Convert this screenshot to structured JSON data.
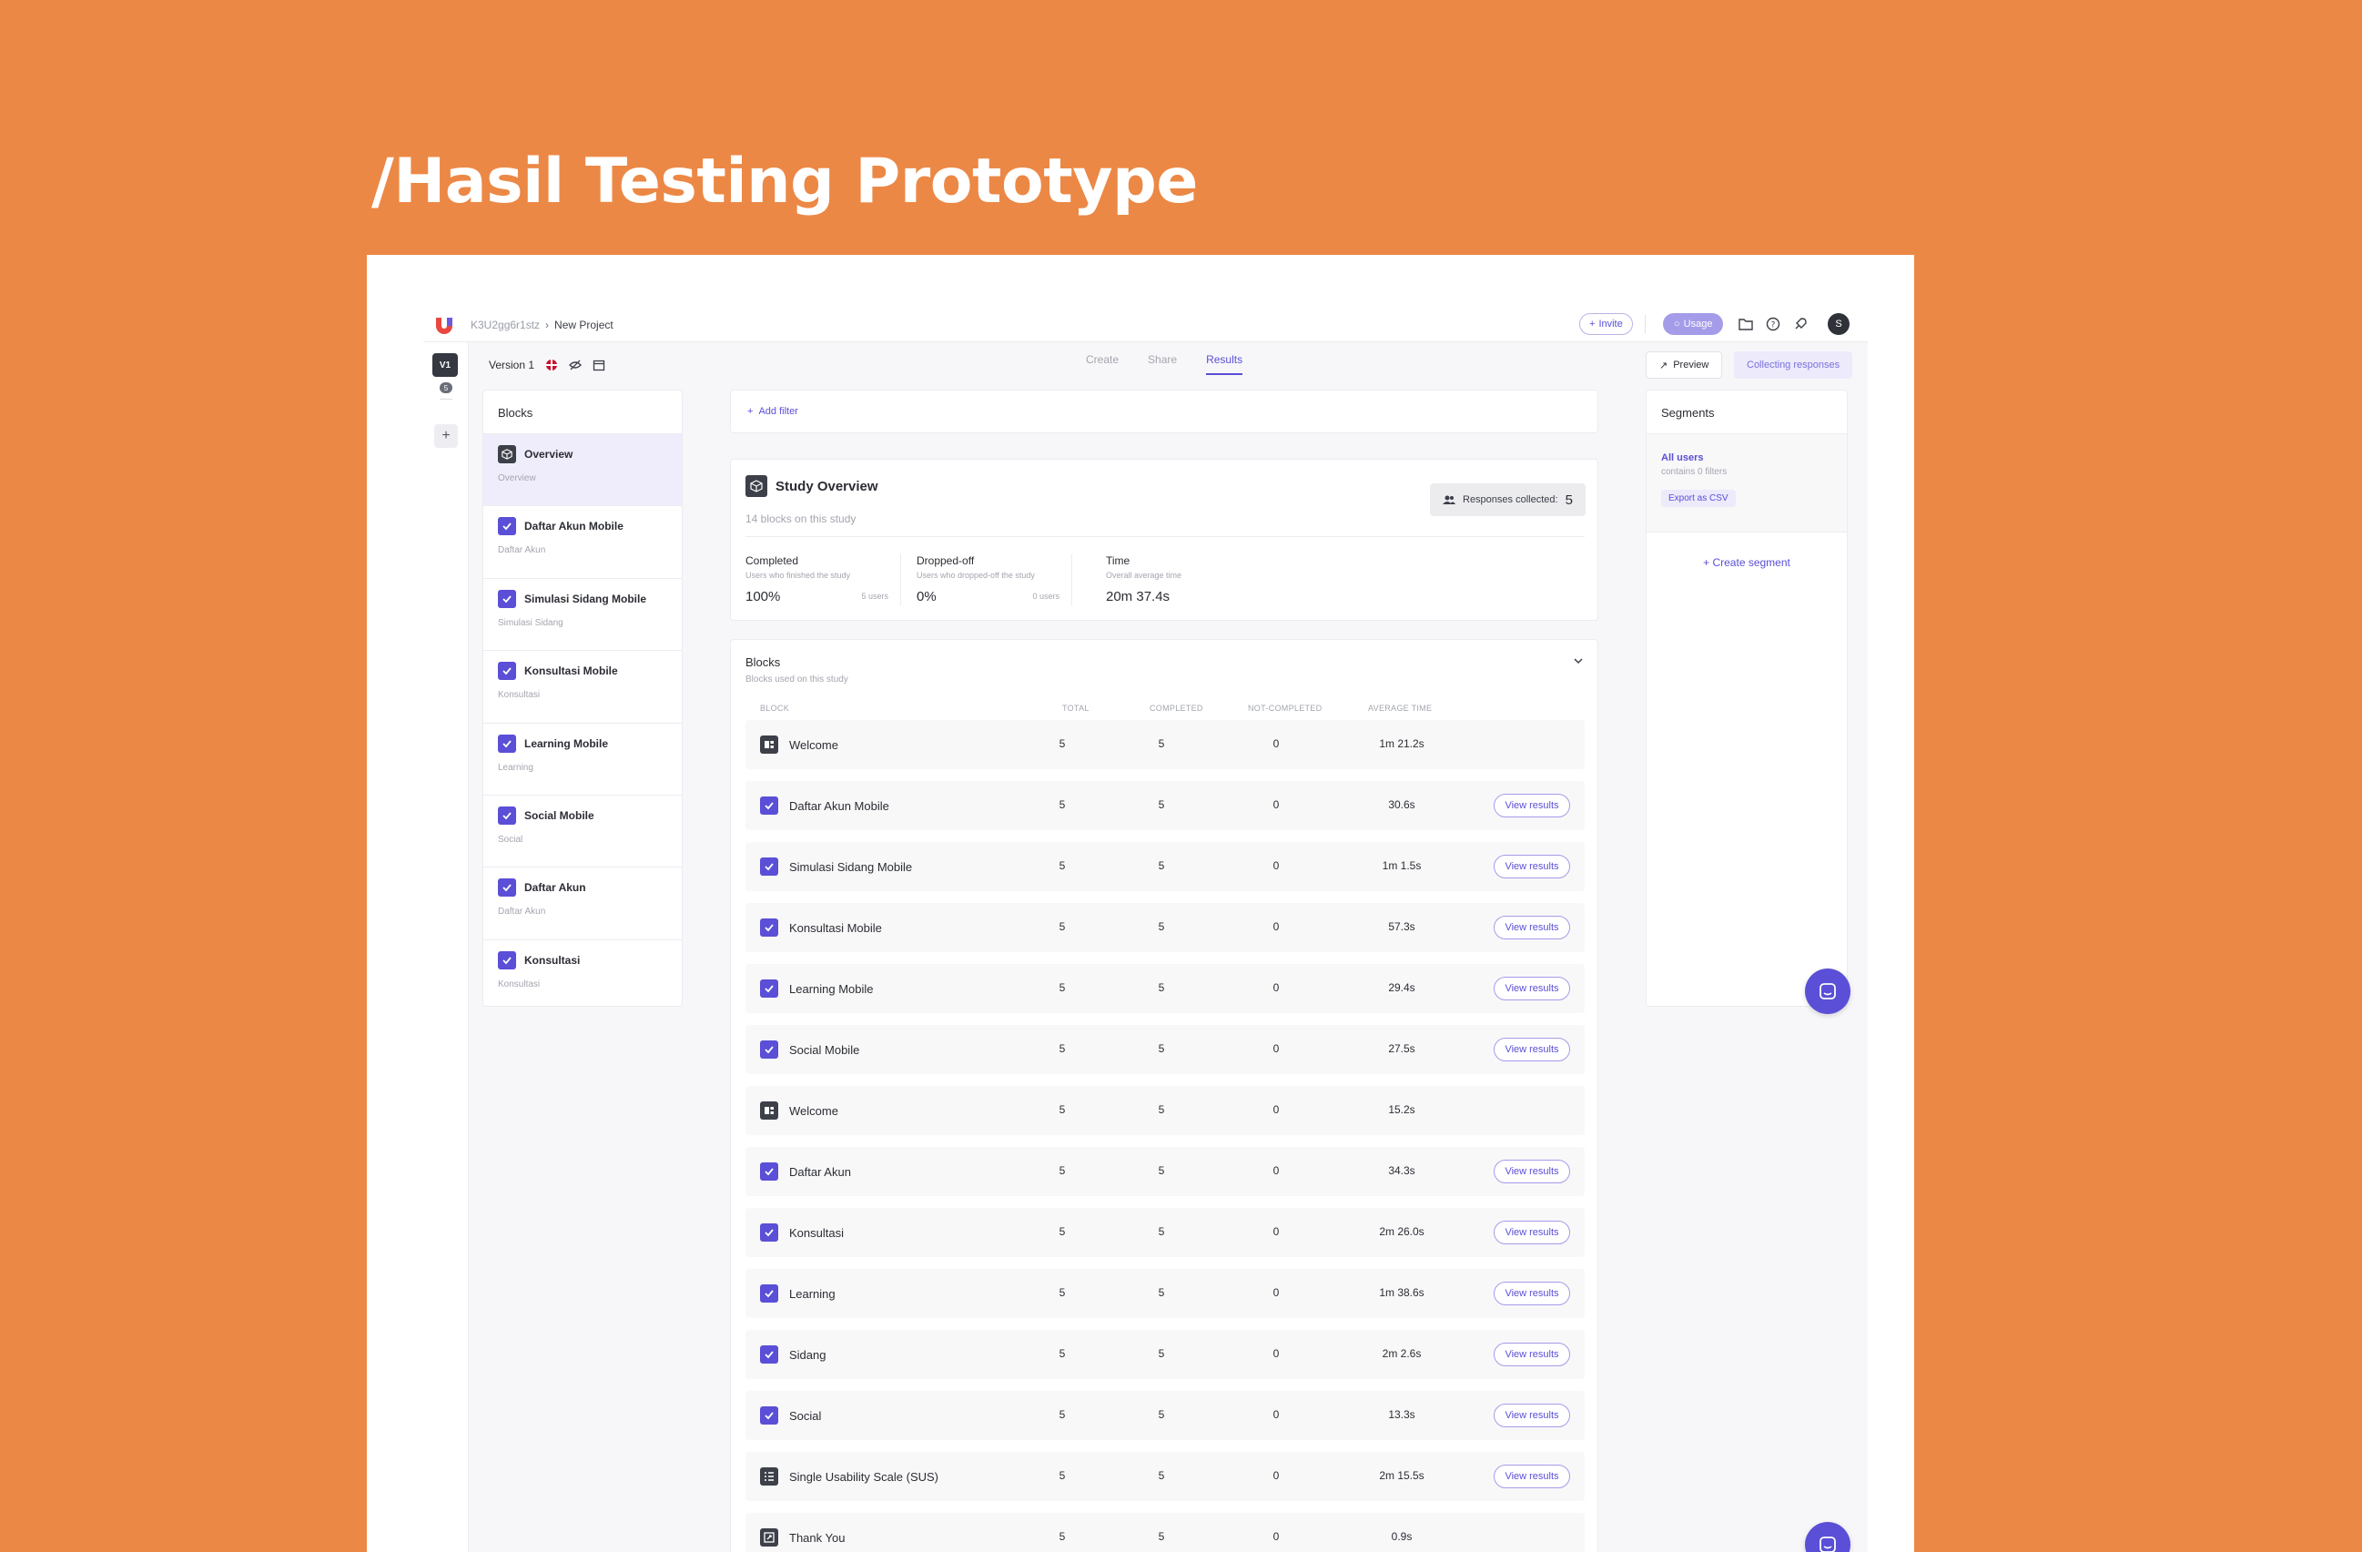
{
  "hero": {
    "title": "/Hasil Testing Prototype"
  },
  "topbar": {
    "project_id": "K3U2gg6r1stz",
    "project_name": "New Project",
    "invite_label": "Invite",
    "usage_label": "Usage",
    "avatar_initial": "S"
  },
  "rail": {
    "version_badge": "V1",
    "version_count": "5",
    "add_label": "+"
  },
  "subheader": {
    "version_label": "Version 1",
    "tabs": [
      {
        "label": "Create",
        "active": false
      },
      {
        "label": "Share",
        "active": false
      },
      {
        "label": "Results",
        "active": true
      }
    ],
    "preview_label": "Preview",
    "collecting_label": "Collecting responses"
  },
  "blocks_sidebar": {
    "title": "Blocks",
    "items": [
      {
        "title": "Overview",
        "subtitle": "Overview",
        "icon": "cube-icon",
        "active": true
      },
      {
        "title": "Daftar Akun Mobile",
        "subtitle": "Daftar Akun",
        "icon": "check-icon"
      },
      {
        "title": "Simulasi Sidang Mobile",
        "subtitle": "Simulasi Sidang",
        "icon": "check-icon"
      },
      {
        "title": "Konsultasi Mobile",
        "subtitle": "Konsultasi",
        "icon": "check-icon"
      },
      {
        "title": "Learning Mobile",
        "subtitle": "Learning",
        "icon": "check-icon"
      },
      {
        "title": "Social Mobile",
        "subtitle": "Social",
        "icon": "check-icon"
      },
      {
        "title": "Daftar Akun",
        "subtitle": "Daftar Akun",
        "icon": "check-icon"
      },
      {
        "title": "Konsultasi",
        "subtitle": "Konsultasi",
        "icon": "check-icon"
      }
    ]
  },
  "filter": {
    "add_label": "Add filter"
  },
  "overview": {
    "title": "Study Overview",
    "subtitle": "14 blocks on this study",
    "responses_label": "Responses collected:",
    "responses_value": "5",
    "stats": [
      {
        "name": "Completed",
        "desc": "Users who finished the study",
        "value": "100%",
        "users": "5 users"
      },
      {
        "name": "Dropped-off",
        "desc": "Users who dropped-off the study",
        "value": "0%",
        "users": "0 users"
      },
      {
        "name": "Time",
        "desc": "Overall average time",
        "value": "20m 37.4s",
        "users": ""
      }
    ]
  },
  "blocks_table": {
    "title": "Blocks",
    "subtitle": "Blocks used on this study",
    "headers": {
      "block": "BLOCK",
      "total": "TOTAL",
      "completed": "COMPLETED",
      "not_completed": "NOT-COMPLETED",
      "average_time": "AVERAGE TIME"
    },
    "view_results_label": "View results",
    "rows": [
      {
        "name": "Welcome",
        "icon": "welcome-icon",
        "total": "5",
        "completed": "5",
        "not_completed": "0",
        "avg": "1m 21.2s",
        "view": false
      },
      {
        "name": "Daftar Akun Mobile",
        "icon": "check-icon",
        "total": "5",
        "completed": "5",
        "not_completed": "0",
        "avg": "30.6s",
        "view": true
      },
      {
        "name": "Simulasi Sidang Mobile",
        "icon": "check-icon",
        "total": "5",
        "completed": "5",
        "not_completed": "0",
        "avg": "1m 1.5s",
        "view": true
      },
      {
        "name": "Konsultasi Mobile",
        "icon": "check-icon",
        "total": "5",
        "completed": "5",
        "not_completed": "0",
        "avg": "57.3s",
        "view": true
      },
      {
        "name": "Learning Mobile",
        "icon": "check-icon",
        "total": "5",
        "completed": "5",
        "not_completed": "0",
        "avg": "29.4s",
        "view": true
      },
      {
        "name": "Social Mobile",
        "icon": "check-icon",
        "total": "5",
        "completed": "5",
        "not_completed": "0",
        "avg": "27.5s",
        "view": true
      },
      {
        "name": "Welcome",
        "icon": "welcome-icon",
        "total": "5",
        "completed": "5",
        "not_completed": "0",
        "avg": "15.2s",
        "view": false
      },
      {
        "name": "Daftar Akun",
        "icon": "check-icon",
        "total": "5",
        "completed": "5",
        "not_completed": "0",
        "avg": "34.3s",
        "view": true
      },
      {
        "name": "Konsultasi",
        "icon": "check-icon",
        "total": "5",
        "completed": "5",
        "not_completed": "0",
        "avg": "2m 26.0s",
        "view": true
      },
      {
        "name": "Learning",
        "icon": "check-icon",
        "total": "5",
        "completed": "5",
        "not_completed": "0",
        "avg": "1m 38.6s",
        "view": true
      },
      {
        "name": "Sidang",
        "icon": "check-icon",
        "total": "5",
        "completed": "5",
        "not_completed": "0",
        "avg": "2m 2.6s",
        "view": true
      },
      {
        "name": "Social",
        "icon": "check-icon",
        "total": "5",
        "completed": "5",
        "not_completed": "0",
        "avg": "13.3s",
        "view": true
      },
      {
        "name": "Single Usability Scale (SUS)",
        "icon": "list-icon",
        "total": "5",
        "completed": "5",
        "not_completed": "0",
        "avg": "2m 15.5s",
        "view": true
      },
      {
        "name": "Thank You",
        "icon": "thankyou-icon",
        "total": "5",
        "completed": "5",
        "not_completed": "0",
        "avg": "0.9s",
        "view": false
      }
    ]
  },
  "segments": {
    "title": "Segments",
    "item_name": "All users",
    "item_desc": "contains 0 filters",
    "export_label": "Export as CSV",
    "create_label": "Create segment"
  },
  "colors": {
    "background": "#EC8845",
    "accent": "#5a4fd6",
    "dark": "#3d4048"
  }
}
